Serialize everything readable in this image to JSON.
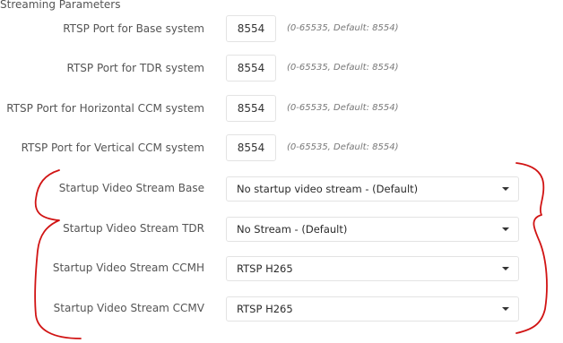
{
  "section": {
    "title": "Streaming Parameters"
  },
  "ports": [
    {
      "label": "RTSP Port for Base system",
      "value": "8554",
      "hint": "(0-65535, Default: 8554)"
    },
    {
      "label": "RTSP Port for TDR system",
      "value": "8554",
      "hint": "(0-65535, Default: 8554)"
    },
    {
      "label": "RTSP Port for Horizontal CCM system",
      "value": "8554",
      "hint": "(0-65535, Default: 8554)"
    },
    {
      "label": "RTSP Port for Vertical CCM system",
      "value": "8554",
      "hint": "(0-65535, Default: 8554)"
    }
  ],
  "streams": [
    {
      "label": "Startup Video Stream Base",
      "value": "No startup video stream - (Default)"
    },
    {
      "label": "Startup Video Stream TDR",
      "value": "No Stream - (Default)"
    },
    {
      "label": "Startup Video Stream CCMH",
      "value": "RTSP H265"
    },
    {
      "label": "Startup Video Stream CCMV",
      "value": "RTSP H265"
    }
  ],
  "annotation": {
    "color": "#d11414"
  },
  "icons": {
    "dropdown": "caret-down-icon"
  }
}
